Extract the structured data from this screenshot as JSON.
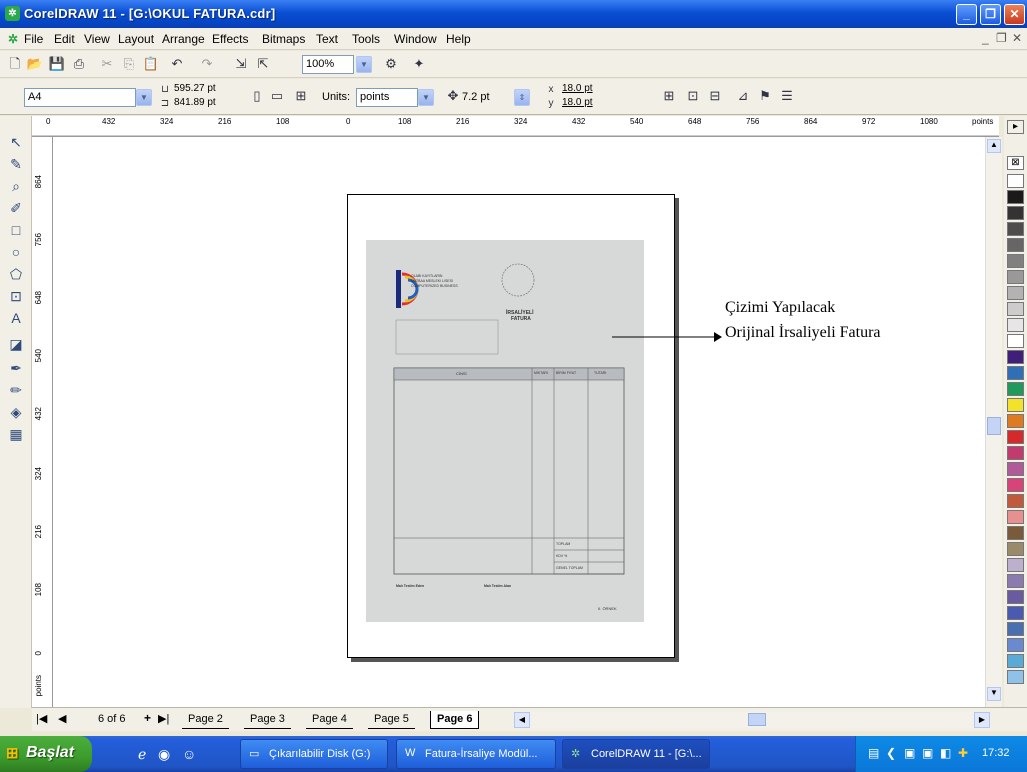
{
  "window": {
    "title": "CorelDRAW 11 - [G:\\OKUL FATURA.cdr]",
    "min": "_",
    "max": "❐",
    "close": "✕"
  },
  "menu": {
    "items": [
      "File",
      "Edit",
      "View",
      "Layout",
      "Arrange",
      "Effects",
      "Bitmaps",
      "Text",
      "Tools",
      "Window",
      "Help"
    ],
    "mdi_min": "_",
    "mdi_restore": "❐",
    "mdi_close": "✕"
  },
  "toolbar": {
    "zoom": "100%",
    "undo_icon": "undo-icon",
    "redo_icon": "redo-icon"
  },
  "property_bar": {
    "paper": "A4",
    "width": "595.27 pt",
    "height": "841.89 pt",
    "units_label": "Units:",
    "units": "points",
    "nudge": "7.2 pt",
    "dup_x": "18.0 pt",
    "dup_y": "18.0 pt"
  },
  "ruler": {
    "h_ticks": [
      "0",
      "432",
      "324",
      "216",
      "108",
      "0",
      "108",
      "216",
      "324",
      "432",
      "540",
      "648",
      "756",
      "864",
      "972",
      "1080"
    ],
    "h_unit": "points",
    "v_ticks": [
      "864",
      "756",
      "648",
      "540",
      "432",
      "324",
      "216",
      "108",
      "0"
    ],
    "v_unit": "points"
  },
  "document": {
    "header_lines": [
      "OLABI KAYITLARIN",
      "MATBAA MESLEKI LISESI",
      "COMPUTERIZED BUSINESS"
    ],
    "title_line1": "İRSALİYELİ",
    "title_line2": "FATURA",
    "col_headers": [
      "CİNSİ",
      "MİKTARI",
      "BİRİM FİYAT",
      "TUTARI"
    ],
    "total_labels": [
      "TOPLAM",
      "KDV %",
      "GENEL TOPLAM"
    ],
    "bottom_right": "II. ÖRNEK",
    "signature1": "Malı Teslim Eden",
    "signature2": "Malı Teslim Alan"
  },
  "annotation": {
    "line1": "Çizimi Yapılacak",
    "line2": "Orijinal İrsaliyeli Fatura"
  },
  "pages": {
    "counter": "6 of 6",
    "tabs": [
      "Page 2",
      "Page 3",
      "Page 4",
      "Page 5",
      "Page 6"
    ],
    "active": "Page 6"
  },
  "taskbar": {
    "start": "Başlat",
    "tasks": [
      "Çıkarılabilir Disk (G:)",
      "Fatura-İrsaliye Modül...",
      "CorelDRAW 11 - [G:\\..."
    ],
    "time": "17:32"
  },
  "palette_colors": [
    "#ffffff",
    "#1a1a1a",
    "#333333",
    "#4d4d4d",
    "#666666",
    "#808080",
    "#999999",
    "#b3b3b3",
    "#cccccc",
    "#e6e6e6",
    "#ffffff",
    "#3f1f7a",
    "#2f6fb6",
    "#1f9a5a",
    "#f2e32a",
    "#e07a20",
    "#d62a2a",
    "#c23a6e",
    "#b05a9a",
    "#d8447a",
    "#c05a3a",
    "#e89090",
    "#7a5a3a",
    "#9a8a6a",
    "#bdb0cf",
    "#8a7ab0",
    "#6a5aa0",
    "#4a5ab0",
    "#4a6fb0",
    "#6a8ad0",
    "#5aaad8",
    "#8ec2e8"
  ]
}
